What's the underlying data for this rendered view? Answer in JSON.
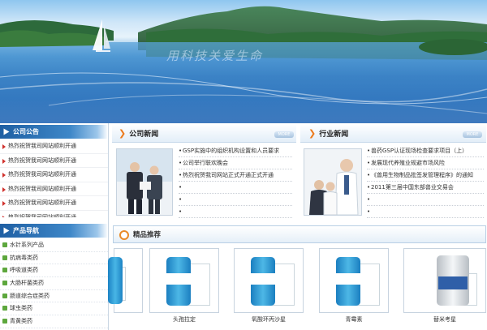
{
  "banner": {
    "slogan": "用科技关爱生命"
  },
  "sidebar": {
    "notice_title": "公司公告",
    "notices": [
      "热烈祝贺我司网站顺利开通",
      "热烈祝贺我司网站顺利开通",
      "热烈祝贺我司网站顺利开通",
      "热烈祝贺我司网站顺利开通",
      "热烈祝贺我司网站顺利开通",
      "热烈祝贺我司网站顺利开通"
    ],
    "nav_title": "产品导航",
    "nav_items": [
      "水针系列产品",
      "抗病毒类药",
      "呼吸道类药",
      "大肠杆菌类药",
      "肠道综合症类药",
      "球虫类药",
      "青黄类药"
    ]
  },
  "company_news": {
    "title": "公司新闻",
    "more": "MORE",
    "items": [
      "GSP实施中的组织机构设置和人员要求",
      "公司举行联欢晚会",
      "热烈祝贺我司网站正式开通正式开通",
      "",
      "",
      ""
    ]
  },
  "industry_news": {
    "title": "行业新闻",
    "more": "MORE",
    "items": [
      "兽药GSP认证现场检查要求项目（上）",
      "发展现代养殖业规避市场风险",
      "《兽用生物制品批签发管理程序》的通知",
      "2011第三届中国东部兽业交易会",
      "",
      ""
    ]
  },
  "products": {
    "title": "精品推荐",
    "items": [
      {
        "name": "",
        "color": "#2d9fd6"
      },
      {
        "name": "头孢拉定",
        "color": "#2d9fd6"
      },
      {
        "name": "氧酸环丙沙星",
        "color": "#2d9fd6"
      },
      {
        "name": "青霉素",
        "color": "#2d9fd6"
      },
      {
        "name": "替米考星",
        "color": "#d9dde0"
      }
    ]
  }
}
